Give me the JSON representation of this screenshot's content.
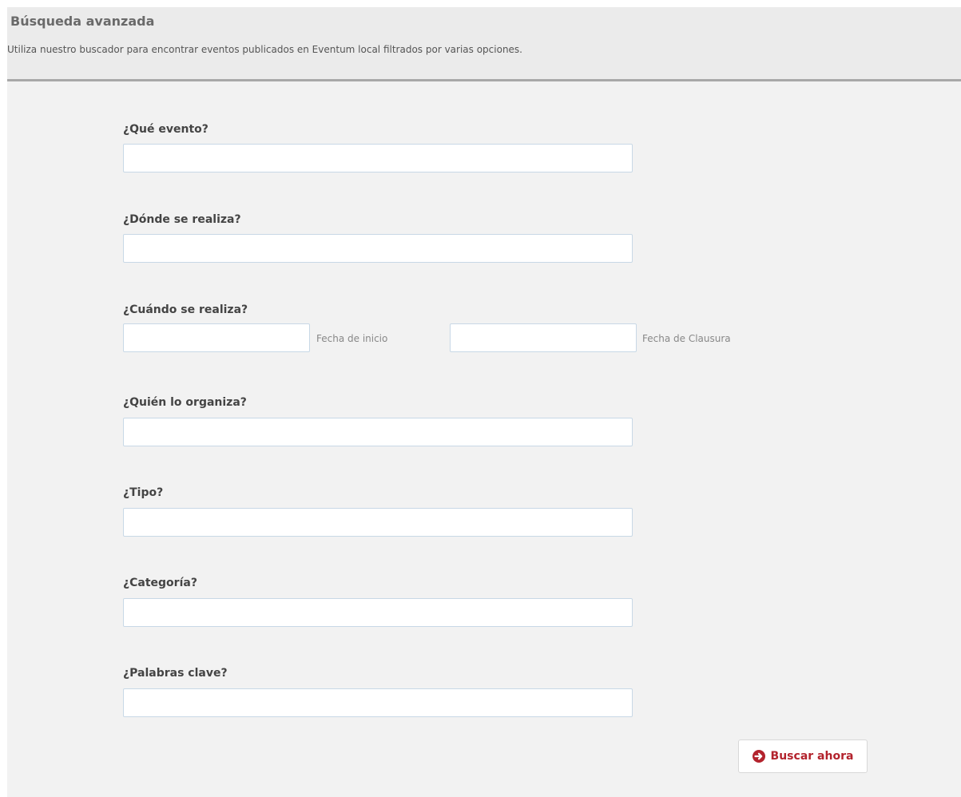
{
  "header": {
    "title": "Búsqueda avanzada",
    "subtitle": "Utiliza nuestro buscador para encontrar eventos publicados en Eventum local filtrados por varias opciones."
  },
  "form": {
    "event": {
      "label": "¿Qué evento?",
      "value": ""
    },
    "place": {
      "label": "¿Dónde se realiza?",
      "value": ""
    },
    "when": {
      "label": "¿Cuándo se realiza?",
      "start_value": "",
      "start_hint": "Fecha de inicio",
      "end_value": "",
      "end_hint": "Fecha de Clausura"
    },
    "organizer": {
      "label": "¿Quién lo organiza?",
      "value": ""
    },
    "type": {
      "label": "¿Tipo?",
      "value": ""
    },
    "category": {
      "label": "¿Categoría?",
      "value": ""
    },
    "keywords": {
      "label": "¿Palabras clave?",
      "value": ""
    }
  },
  "search_button": {
    "label": "Buscar ahora",
    "icon": "circle-arrow-right-icon"
  },
  "colors": {
    "accent": "#b3232d",
    "panel_background": "#f2f2f2",
    "header_background": "#ebebeb",
    "input_border": "#c8d8e6"
  }
}
